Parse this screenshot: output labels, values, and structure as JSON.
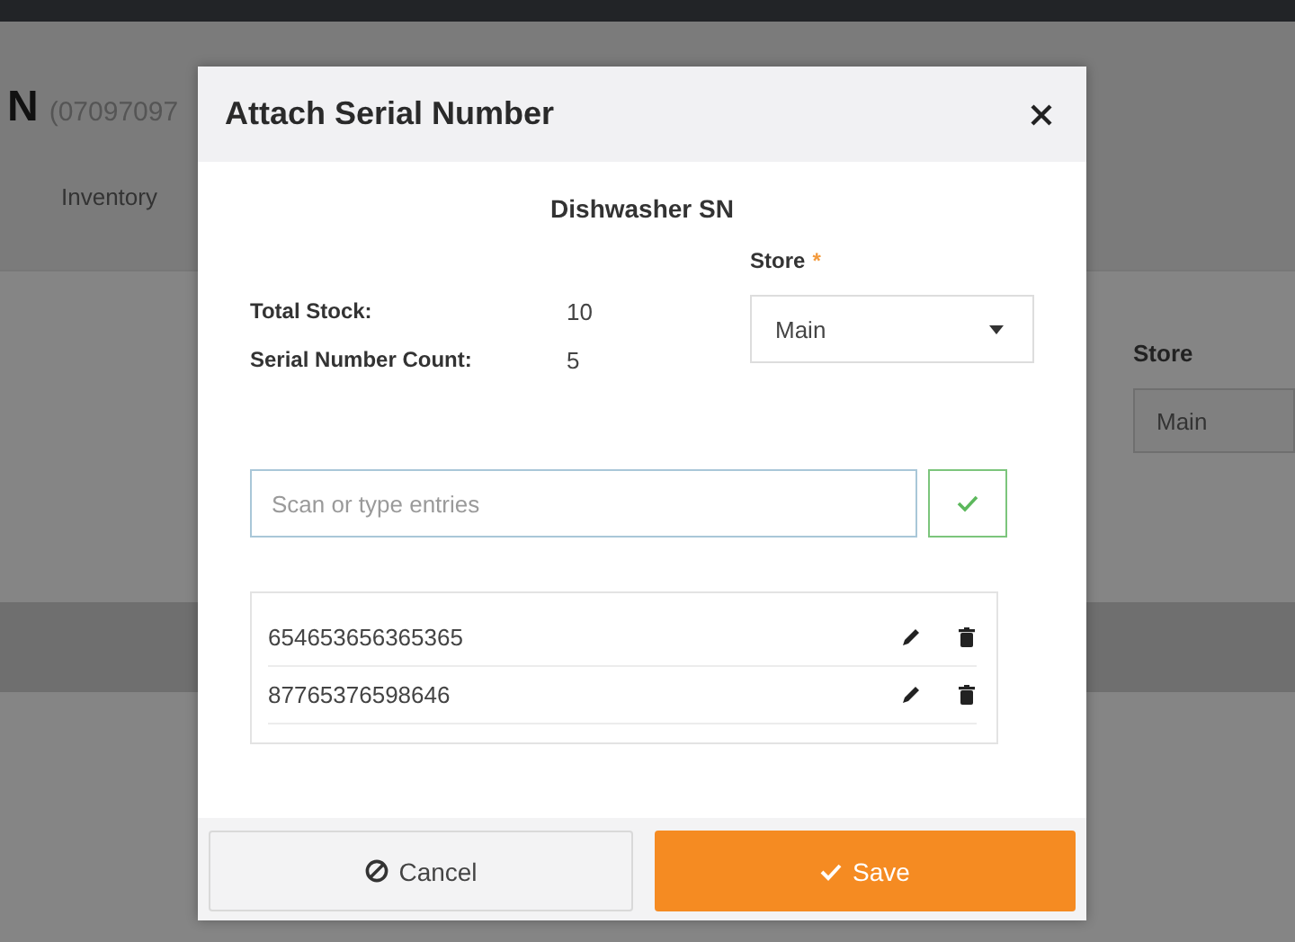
{
  "page": {
    "title": "N",
    "code": "(07097097",
    "tabs": [
      "Inventory"
    ],
    "store_label": "Store",
    "store_value": "Main"
  },
  "dialog": {
    "title": "Attach Serial Number",
    "product": "Dishwasher SN",
    "stats": [
      {
        "label": "Total Stock:",
        "value": "10"
      },
      {
        "label": "Serial Number Count:",
        "value": "5"
      }
    ],
    "store": {
      "label": "Store",
      "required_mark": "*",
      "value": "Main"
    },
    "entry": {
      "placeholder": "Scan or type entries"
    },
    "serials": [
      "654653656365365",
      "87765376598646"
    ],
    "buttons": [
      {
        "label": "Cancel",
        "kind": "cancel"
      },
      {
        "label": "Save",
        "kind": "save"
      }
    ]
  }
}
